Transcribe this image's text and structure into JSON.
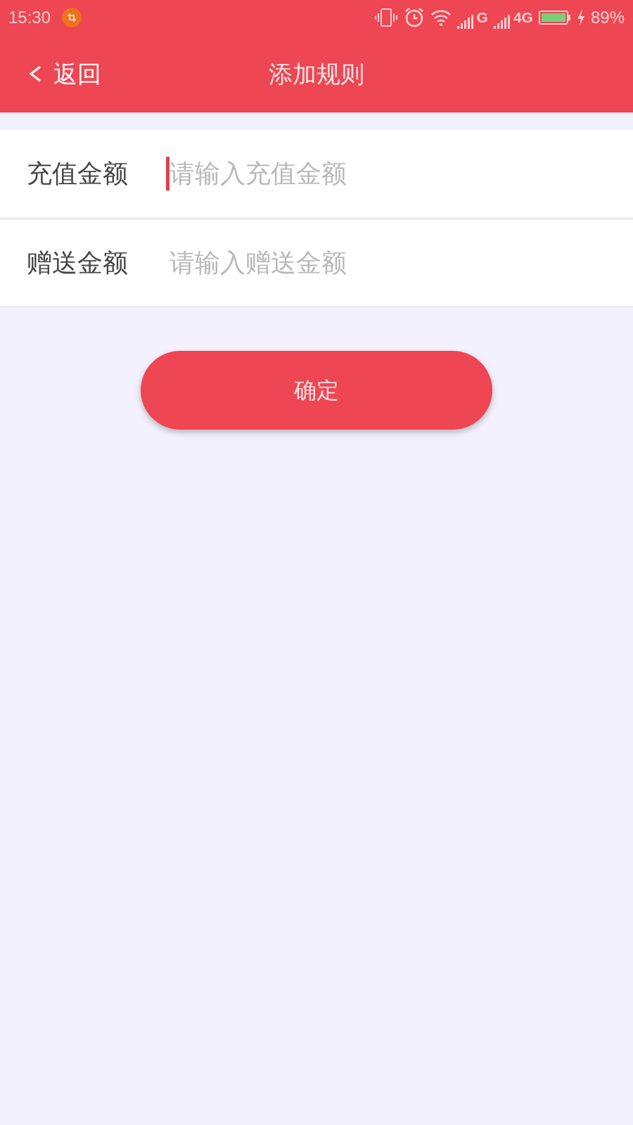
{
  "status_bar": {
    "time": "15:30",
    "network_1": "G",
    "network_2": "4G",
    "battery": "89%"
  },
  "header": {
    "back": "返回",
    "title": "添加规则"
  },
  "fields": [
    {
      "label": "充值金额",
      "placeholder": "请输入充值金额",
      "focused": true
    },
    {
      "label": "赠送金额",
      "placeholder": "请输入赠送金额",
      "focused": false
    }
  ],
  "confirm_button": "确定"
}
